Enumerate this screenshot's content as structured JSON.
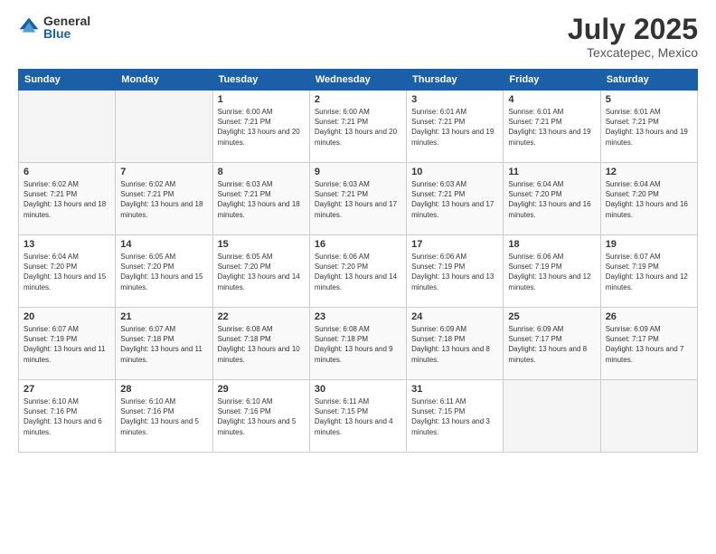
{
  "header": {
    "logo_general": "General",
    "logo_blue": "Blue",
    "month_title": "July 2025",
    "location": "Texcatepec, Mexico"
  },
  "days_of_week": [
    "Sunday",
    "Monday",
    "Tuesday",
    "Wednesday",
    "Thursday",
    "Friday",
    "Saturday"
  ],
  "weeks": [
    [
      {
        "day": "",
        "info": ""
      },
      {
        "day": "",
        "info": ""
      },
      {
        "day": "1",
        "info": "Sunrise: 6:00 AM\nSunset: 7:21 PM\nDaylight: 13 hours and 20 minutes."
      },
      {
        "day": "2",
        "info": "Sunrise: 6:00 AM\nSunset: 7:21 PM\nDaylight: 13 hours and 20 minutes."
      },
      {
        "day": "3",
        "info": "Sunrise: 6:01 AM\nSunset: 7:21 PM\nDaylight: 13 hours and 19 minutes."
      },
      {
        "day": "4",
        "info": "Sunrise: 6:01 AM\nSunset: 7:21 PM\nDaylight: 13 hours and 19 minutes."
      },
      {
        "day": "5",
        "info": "Sunrise: 6:01 AM\nSunset: 7:21 PM\nDaylight: 13 hours and 19 minutes."
      }
    ],
    [
      {
        "day": "6",
        "info": "Sunrise: 6:02 AM\nSunset: 7:21 PM\nDaylight: 13 hours and 18 minutes."
      },
      {
        "day": "7",
        "info": "Sunrise: 6:02 AM\nSunset: 7:21 PM\nDaylight: 13 hours and 18 minutes."
      },
      {
        "day": "8",
        "info": "Sunrise: 6:03 AM\nSunset: 7:21 PM\nDaylight: 13 hours and 18 minutes."
      },
      {
        "day": "9",
        "info": "Sunrise: 6:03 AM\nSunset: 7:21 PM\nDaylight: 13 hours and 17 minutes."
      },
      {
        "day": "10",
        "info": "Sunrise: 6:03 AM\nSunset: 7:21 PM\nDaylight: 13 hours and 17 minutes."
      },
      {
        "day": "11",
        "info": "Sunrise: 6:04 AM\nSunset: 7:20 PM\nDaylight: 13 hours and 16 minutes."
      },
      {
        "day": "12",
        "info": "Sunrise: 6:04 AM\nSunset: 7:20 PM\nDaylight: 13 hours and 16 minutes."
      }
    ],
    [
      {
        "day": "13",
        "info": "Sunrise: 6:04 AM\nSunset: 7:20 PM\nDaylight: 13 hours and 15 minutes."
      },
      {
        "day": "14",
        "info": "Sunrise: 6:05 AM\nSunset: 7:20 PM\nDaylight: 13 hours and 15 minutes."
      },
      {
        "day": "15",
        "info": "Sunrise: 6:05 AM\nSunset: 7:20 PM\nDaylight: 13 hours and 14 minutes."
      },
      {
        "day": "16",
        "info": "Sunrise: 6:06 AM\nSunset: 7:20 PM\nDaylight: 13 hours and 14 minutes."
      },
      {
        "day": "17",
        "info": "Sunrise: 6:06 AM\nSunset: 7:19 PM\nDaylight: 13 hours and 13 minutes."
      },
      {
        "day": "18",
        "info": "Sunrise: 6:06 AM\nSunset: 7:19 PM\nDaylight: 13 hours and 12 minutes."
      },
      {
        "day": "19",
        "info": "Sunrise: 6:07 AM\nSunset: 7:19 PM\nDaylight: 13 hours and 12 minutes."
      }
    ],
    [
      {
        "day": "20",
        "info": "Sunrise: 6:07 AM\nSunset: 7:19 PM\nDaylight: 13 hours and 11 minutes."
      },
      {
        "day": "21",
        "info": "Sunrise: 6:07 AM\nSunset: 7:18 PM\nDaylight: 13 hours and 11 minutes."
      },
      {
        "day": "22",
        "info": "Sunrise: 6:08 AM\nSunset: 7:18 PM\nDaylight: 13 hours and 10 minutes."
      },
      {
        "day": "23",
        "info": "Sunrise: 6:08 AM\nSunset: 7:18 PM\nDaylight: 13 hours and 9 minutes."
      },
      {
        "day": "24",
        "info": "Sunrise: 6:09 AM\nSunset: 7:18 PM\nDaylight: 13 hours and 8 minutes."
      },
      {
        "day": "25",
        "info": "Sunrise: 6:09 AM\nSunset: 7:17 PM\nDaylight: 13 hours and 8 minutes."
      },
      {
        "day": "26",
        "info": "Sunrise: 6:09 AM\nSunset: 7:17 PM\nDaylight: 13 hours and 7 minutes."
      }
    ],
    [
      {
        "day": "27",
        "info": "Sunrise: 6:10 AM\nSunset: 7:16 PM\nDaylight: 13 hours and 6 minutes."
      },
      {
        "day": "28",
        "info": "Sunrise: 6:10 AM\nSunset: 7:16 PM\nDaylight: 13 hours and 5 minutes."
      },
      {
        "day": "29",
        "info": "Sunrise: 6:10 AM\nSunset: 7:16 PM\nDaylight: 13 hours and 5 minutes."
      },
      {
        "day": "30",
        "info": "Sunrise: 6:11 AM\nSunset: 7:15 PM\nDaylight: 13 hours and 4 minutes."
      },
      {
        "day": "31",
        "info": "Sunrise: 6:11 AM\nSunset: 7:15 PM\nDaylight: 13 hours and 3 minutes."
      },
      {
        "day": "",
        "info": ""
      },
      {
        "day": "",
        "info": ""
      }
    ]
  ]
}
